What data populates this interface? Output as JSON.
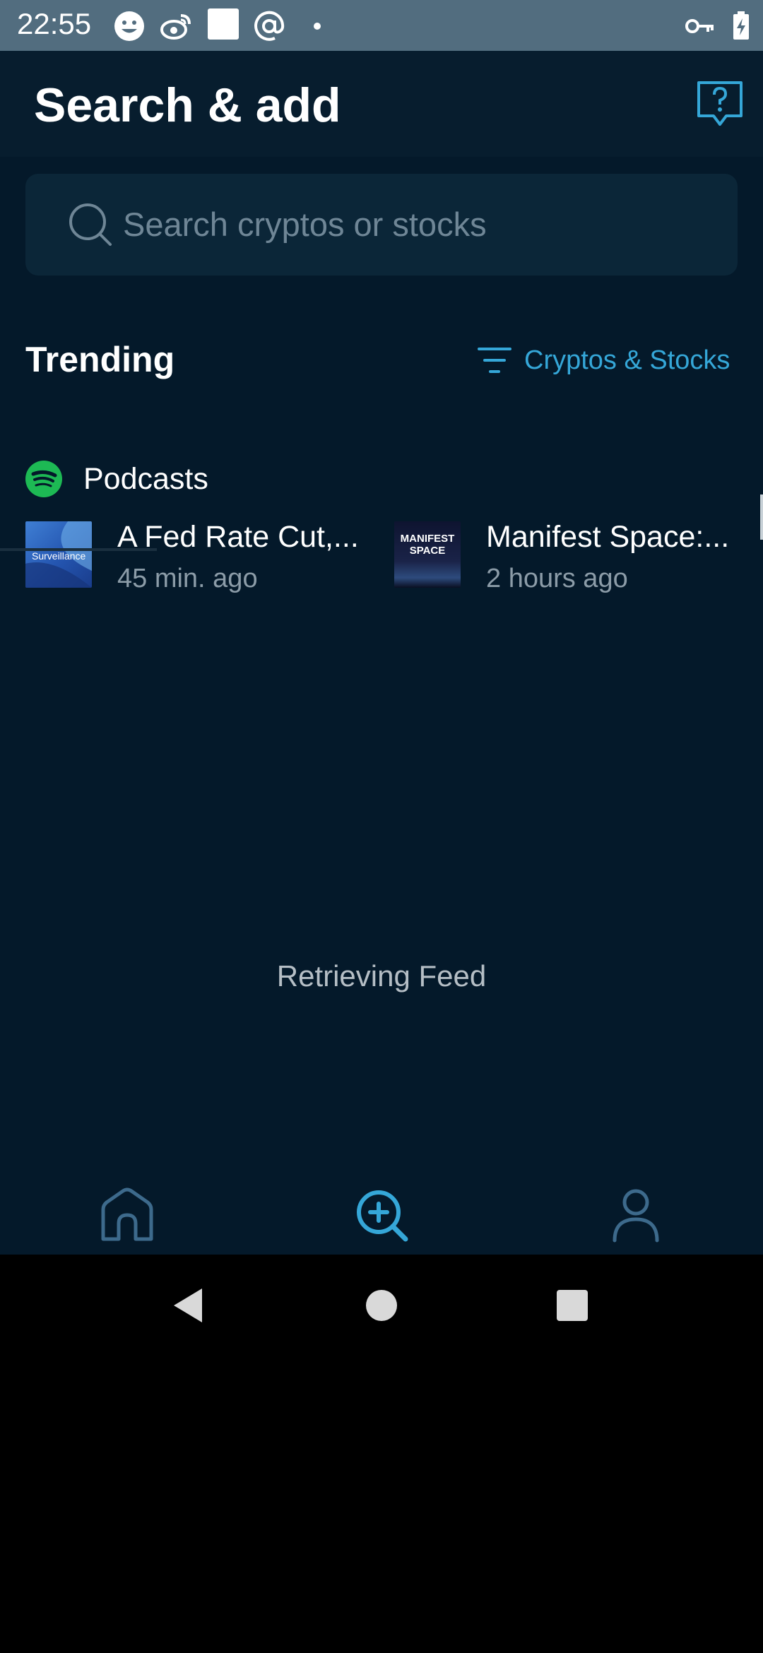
{
  "status_bar": {
    "time": "22:55",
    "icons": [
      "smiley-icon",
      "weibo-icon",
      "square-icon",
      "at-sign-icon",
      "dot-icon",
      "vpn-key-icon",
      "battery-charging-icon"
    ]
  },
  "header": {
    "title": "Search & add",
    "help_icon": "help-question-icon"
  },
  "search": {
    "placeholder": "Search cryptos or stocks"
  },
  "trending": {
    "title": "Trending",
    "filter_label": "Cryptos & Stocks"
  },
  "podcasts": {
    "label": "Podcasts",
    "items": [
      {
        "title": "A Fed Rate Cut,...",
        "time": "45 min. ago",
        "thumb_text": "Surveillance"
      },
      {
        "title": "Manifest Space:...",
        "time": "2 hours ago",
        "thumb_text": "MANIFEST SPACE"
      }
    ]
  },
  "feed": {
    "status": "Retrieving Feed"
  },
  "bottom_nav": {
    "tabs": [
      "home-icon",
      "search-add-icon",
      "profile-icon"
    ],
    "active": "search-add-icon"
  },
  "colors": {
    "status_bar": "#526d7f",
    "background": "#04192a",
    "accent": "#35a7d8",
    "muted_text": "#8c9ca8",
    "spotify_green": "#1db954"
  }
}
